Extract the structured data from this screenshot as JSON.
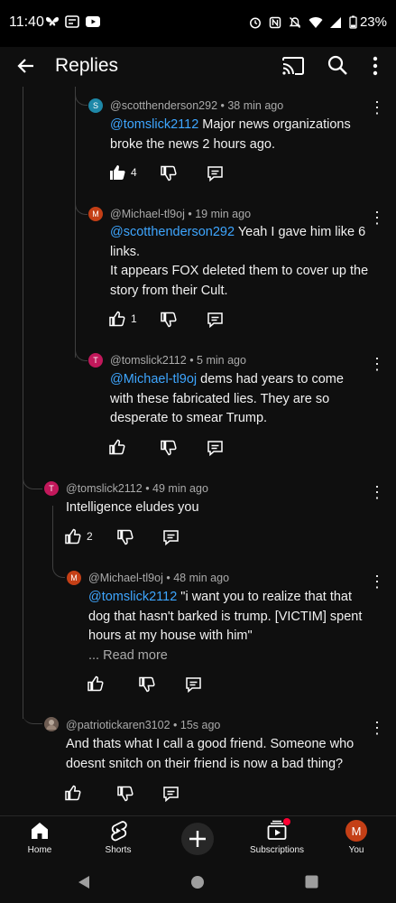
{
  "status_bar": {
    "time": "11:40",
    "battery": "23%"
  },
  "header": {
    "title": "Replies"
  },
  "comments": [
    {
      "avatar_letter": "S",
      "avatar_color": "#1e88a8",
      "author": "@scotthenderson292",
      "time": "38 min ago",
      "mention": "@tomslick2112",
      "lines": [
        " Major news organizations",
        "broke the news 2 hours ago."
      ],
      "likes": "4",
      "liked": true
    },
    {
      "avatar_letter": "M",
      "avatar_color": "#c43f16",
      "author": "@Michael-tl9oj",
      "time": "19 min ago",
      "mention": "@scotthenderson292",
      "lines": [
        " Yeah I gave him like 6",
        "links.",
        "It appears FOX deleted them to cover up the",
        "story from their Cult."
      ],
      "likes": "1"
    },
    {
      "avatar_letter": "T",
      "avatar_color": "#c2185b",
      "author": "@tomslick2112",
      "time": "5 min ago",
      "mention": "@Michael-tl9oj",
      "lines": [
        " dems had years to come",
        "with these fabricated lies. They are so",
        "desperate to smear Trump."
      ],
      "likes": ""
    },
    {
      "avatar_letter": "T",
      "avatar_color": "#c2185b",
      "author": "@tomslick2112",
      "time": "49 min ago",
      "mention": "",
      "lines": [
        "Intelligence eludes you"
      ],
      "likes": "2"
    },
    {
      "avatar_letter": "M",
      "avatar_color": "#c43f16",
      "author": "@Michael-tl9oj",
      "time": "48 min ago",
      "mention": "@tomslick2112",
      "lines": [
        " \"i want you to realize that that",
        "dog that hasn't barked is trump. [VICTIM] spent",
        "hours at my house with him\""
      ],
      "read_more": "... Read more",
      "likes": ""
    },
    {
      "avatar_letter": "",
      "avatar_color": "#6d5c52",
      "author": "@patriotickaren3102",
      "time": "15s ago",
      "mention": "",
      "lines": [
        "And thats what I call a good friend. Someone who",
        "doesnt snitch on their friend is now a bad thing?"
      ],
      "likes": ""
    }
  ],
  "bottom_nav": {
    "items": [
      {
        "label": "Home",
        "icon": "home-icon"
      },
      {
        "label": "Shorts",
        "icon": "shorts-icon"
      },
      {
        "label": "",
        "icon": "create-icon"
      },
      {
        "label": "Subscriptions",
        "icon": "subscriptions-icon"
      },
      {
        "label": "You",
        "icon": "avatar",
        "avatar_letter": "M"
      }
    ]
  },
  "colors": {
    "background": "#0f0f0f",
    "mention": "#3ea6ff",
    "meta": "#aaaaaa",
    "notification_dot": "#ff0033"
  }
}
